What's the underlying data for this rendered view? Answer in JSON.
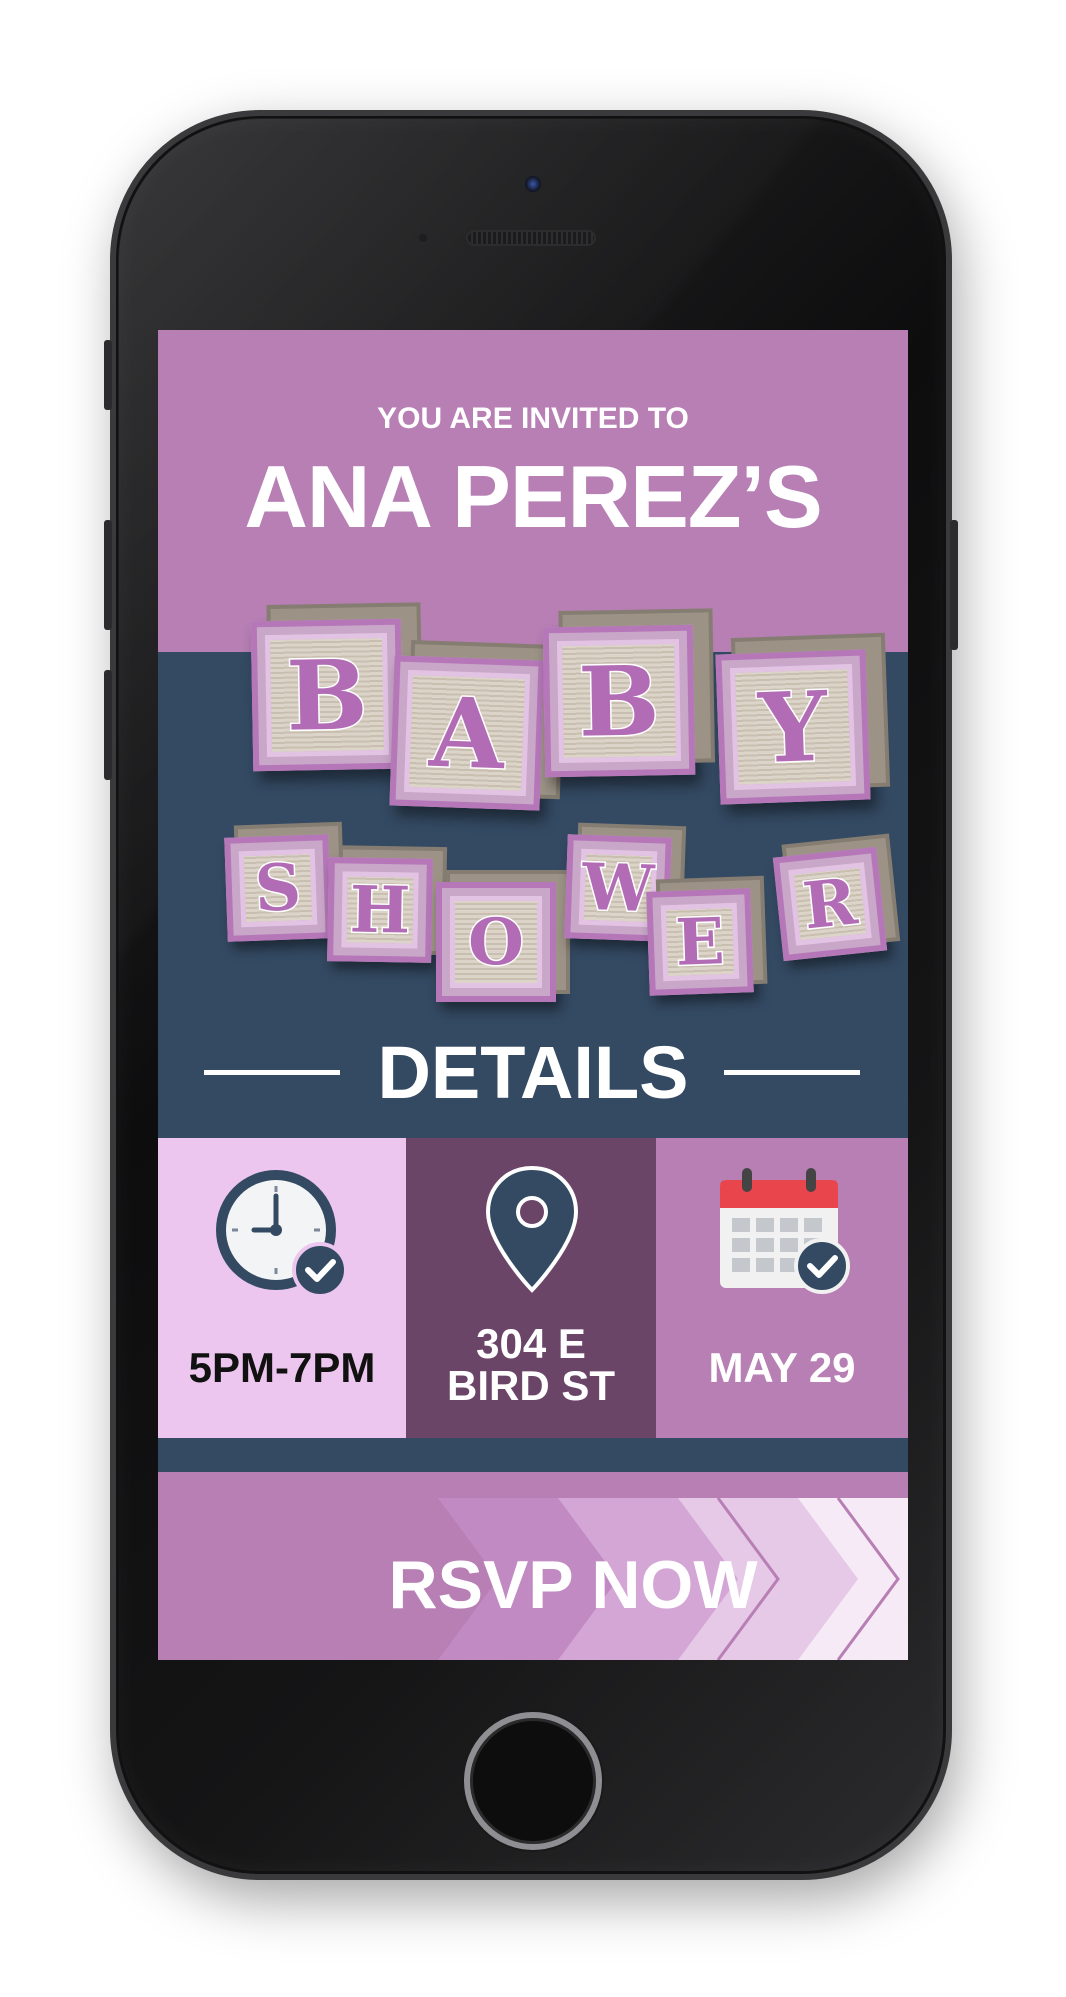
{
  "invite": {
    "intro": "YOU ARE INVITED TO",
    "host": "ANA PEREZ’S"
  },
  "blocks": {
    "row1": [
      "B",
      "A",
      "B",
      "Y"
    ],
    "row2": [
      "S",
      "H",
      "O",
      "W",
      "E",
      "R"
    ]
  },
  "details": {
    "heading": "DETAILS",
    "time": {
      "icon": "clock-check-icon",
      "text": "5PM-7PM"
    },
    "location": {
      "icon": "map-pin-icon",
      "line1": "304 E",
      "line2": "BIRD ST"
    },
    "date": {
      "icon": "calendar-check-icon",
      "text": "MAY 29"
    }
  },
  "rsvp": {
    "label": "RSVP NOW"
  },
  "colors": {
    "purple": "#b77fb4",
    "navy": "#344a63",
    "light_purple": "#ecc6ee",
    "dark_purple": "#6b4568"
  }
}
